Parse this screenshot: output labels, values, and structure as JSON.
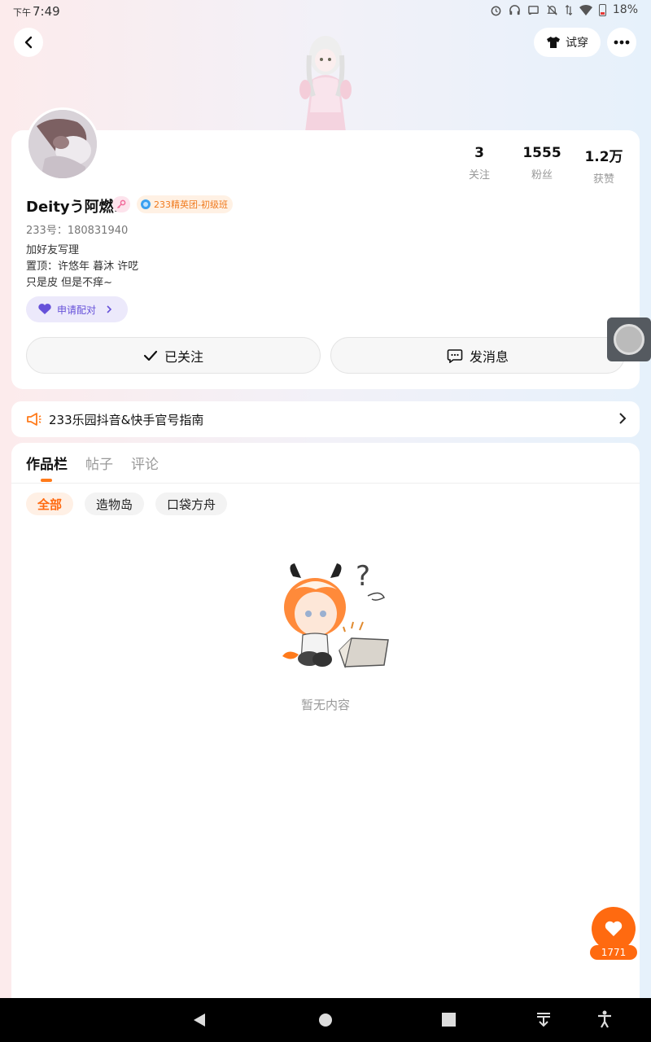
{
  "status_bar": {
    "ampm": "下午",
    "time": "7:49",
    "battery": "18%"
  },
  "header": {
    "try_on_label": "试穿"
  },
  "profile": {
    "username": "Deityう阿燃.",
    "club_badge": "233精英团-初级班",
    "uid": "233号：180831940",
    "bio": [
      "加好友写理",
      "置顶：许悠年 暮沐 许呓",
      "只是皮 但是不痒~"
    ],
    "pair_label": "申请配对",
    "stats": [
      {
        "num": "3",
        "label": "关注"
      },
      {
        "num": "1555",
        "label": "粉丝"
      },
      {
        "num": "1.2万",
        "label": "获赞"
      }
    ],
    "follow_label": "已关注",
    "message_label": "发消息"
  },
  "notice": {
    "text": "233乐园抖音&快手官号指南"
  },
  "content": {
    "tabs": [
      "作品栏",
      "帖子",
      "评论"
    ],
    "active_tab": 0,
    "chips": [
      "全部",
      "造物岛",
      "口袋方舟"
    ],
    "active_chip": 0,
    "empty_text": "暂无内容"
  },
  "like": {
    "count": "1771"
  },
  "colors": {
    "accent": "#ff6a10",
    "pair": "#6651d9"
  }
}
